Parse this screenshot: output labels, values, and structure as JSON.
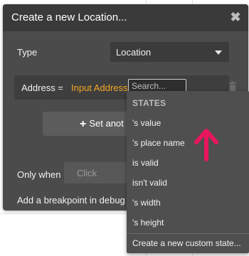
{
  "dialog": {
    "title": "Create a new Location...",
    "close_symbol": "✖"
  },
  "type_row": {
    "label": "Type",
    "value": "Location"
  },
  "address_row": {
    "label": "Address =",
    "expression": "Input Address",
    "search_placeholder": "Search..."
  },
  "set_another": {
    "label": "Set anot"
  },
  "only_when": {
    "label": "Only when",
    "placeholder": "Click"
  },
  "breakpoint": {
    "label": "Add a breakpoint in debug m"
  },
  "dropdown": {
    "header": "STATES",
    "items": [
      "'s value",
      "'s place name",
      "is valid",
      "isn't valid",
      "'s width",
      "'s height"
    ],
    "footer": "Create a new custom state..."
  },
  "colors": {
    "dialog_bg": "#4b4b4b",
    "header_bg": "#3a3a3a",
    "expression": "#f5a623",
    "annotation_arrow": "#e8175d"
  },
  "icons": [
    "close-icon",
    "chevron-down-icon",
    "trash-icon",
    "plus-icon",
    "arrow-up-icon"
  ]
}
